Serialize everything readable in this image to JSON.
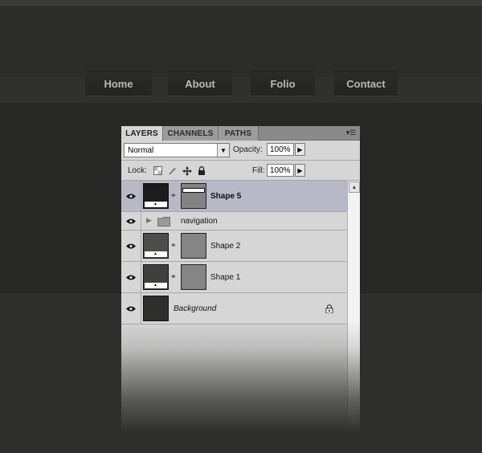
{
  "website": {
    "nav": [
      "Home",
      "About",
      "Folio",
      "Contact"
    ]
  },
  "panel": {
    "tabs": [
      "LAYERS",
      "CHANNELS",
      "PATHS"
    ],
    "menu_icon": "panel-menu-icon",
    "blend_mode": "Normal",
    "opacity_label": "Opacity:",
    "opacity": "100%",
    "lock_label": "Lock:",
    "fill_label": "Fill:",
    "fill": "100%",
    "layers": [
      {
        "name": "Shape 5",
        "type": "shape",
        "selected": true,
        "visible": true
      },
      {
        "name": "navigation",
        "type": "group",
        "selected": false,
        "visible": true
      },
      {
        "name": "Shape 2",
        "type": "shape",
        "selected": false,
        "visible": true
      },
      {
        "name": "Shape 1",
        "type": "shape",
        "selected": false,
        "visible": true
      },
      {
        "name": "Background",
        "type": "background",
        "selected": false,
        "visible": true,
        "locked": true
      }
    ]
  },
  "colors": {
    "page_bg": "#2e2f2b",
    "panel_bg": "#d6d6d6",
    "selected_layer": "#b7b9c7",
    "nav_text": "#b9bab5"
  }
}
